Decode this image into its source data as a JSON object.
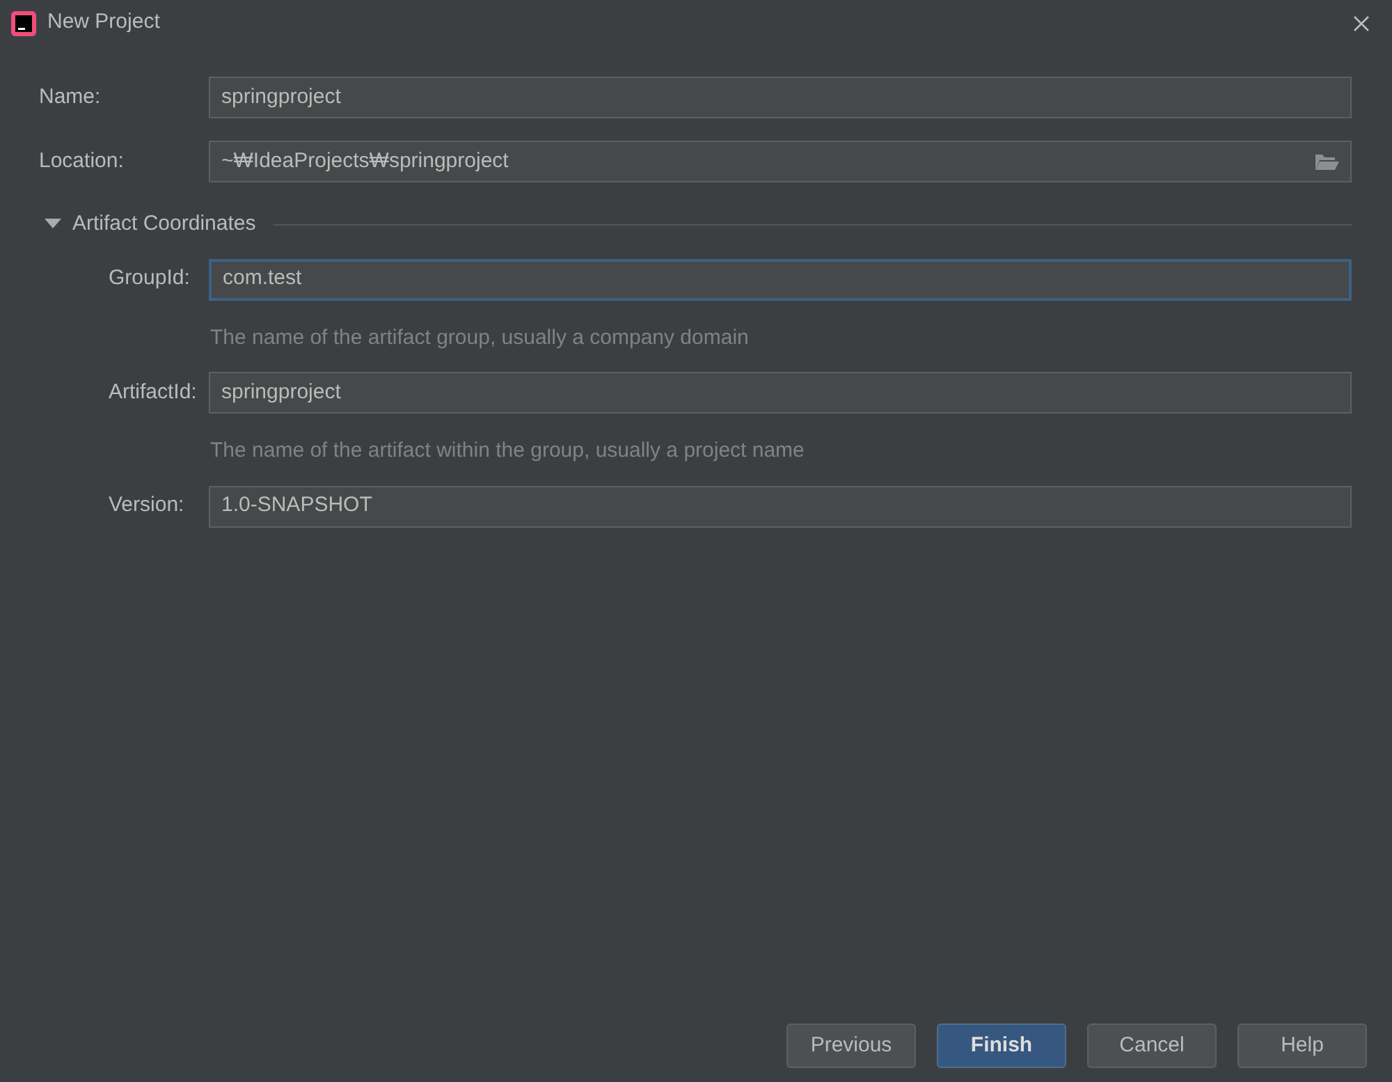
{
  "window": {
    "title": "New Project"
  },
  "fields": [
    {
      "label": "Name:",
      "value": "springproject",
      "focused": false
    },
    {
      "label": "Location:",
      "value": "~₩IdeaProjects₩springproject",
      "focused": false,
      "browse": true
    }
  ],
  "section": {
    "title": "Artifact Coordinates",
    "expanded": true,
    "fields": [
      {
        "label": "GroupId:",
        "value": "com.test",
        "focused": true,
        "hint": "The name of the artifact group, usually a company domain"
      },
      {
        "label": "ArtifactId:",
        "value": "springproject",
        "focused": false,
        "hint": "The name of the artifact within the group, usually a project name"
      },
      {
        "label": "Version:",
        "value": "1.0-SNAPSHOT",
        "focused": false
      }
    ]
  },
  "buttons": [
    {
      "label": "Previous",
      "kind": "default"
    },
    {
      "label": "Finish",
      "kind": "primary"
    },
    {
      "label": "Cancel",
      "kind": "default"
    },
    {
      "label": "Help",
      "kind": "default"
    }
  ]
}
